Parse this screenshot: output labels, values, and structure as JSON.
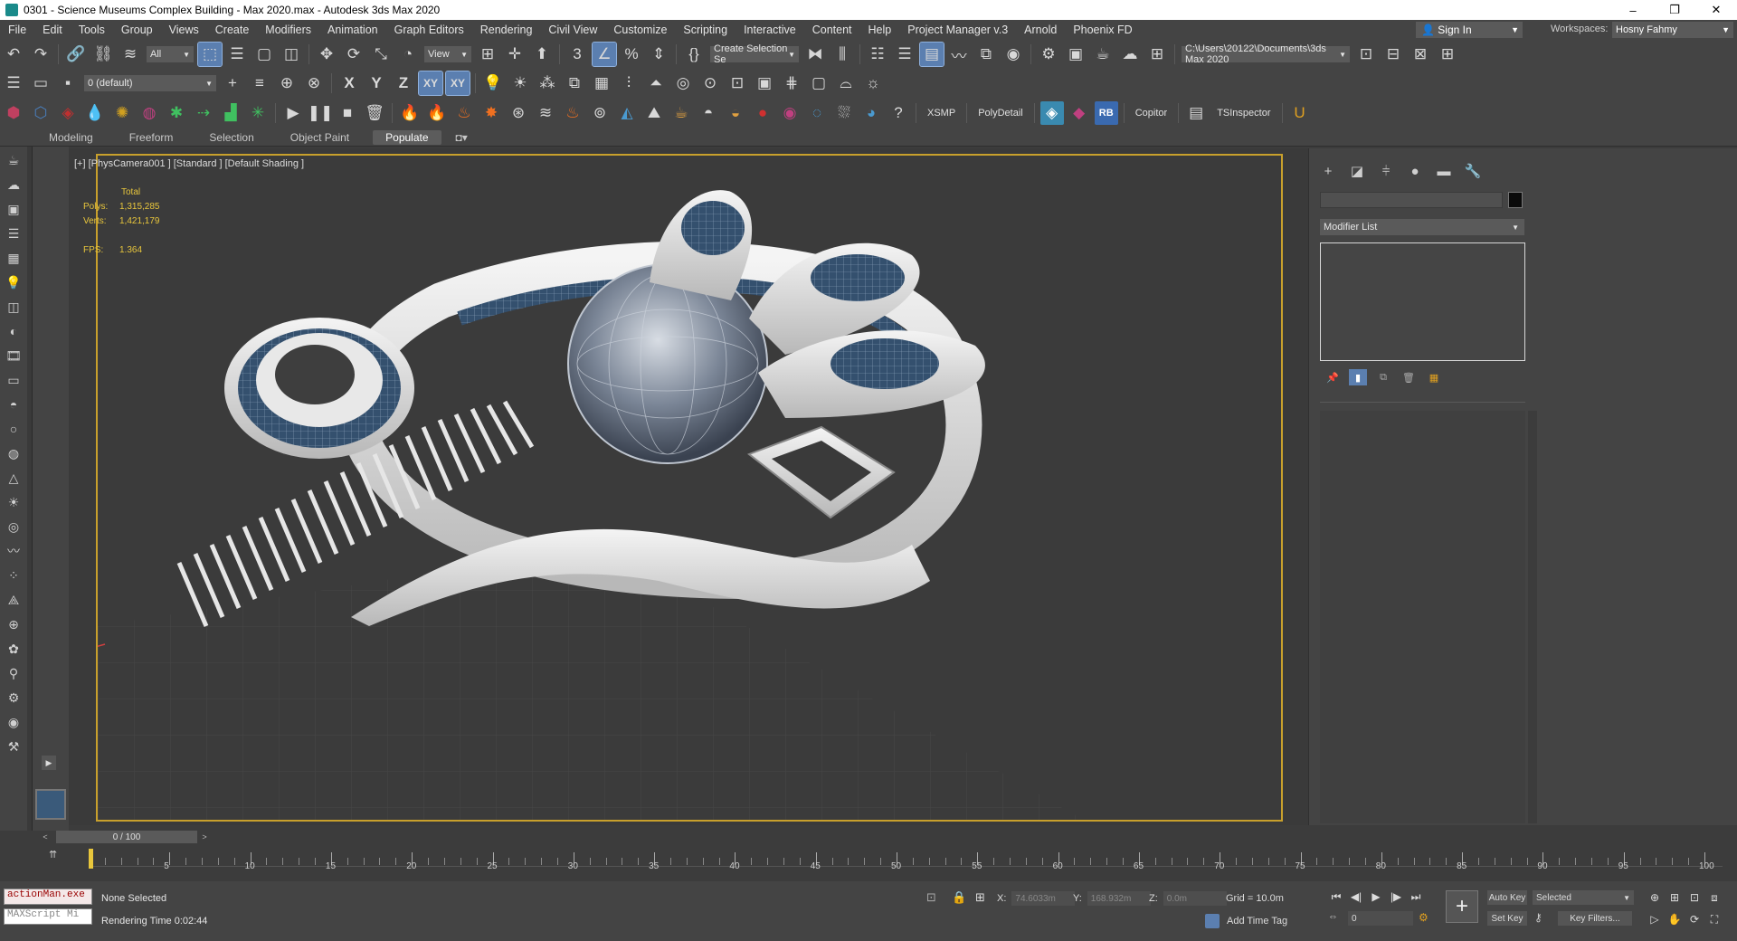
{
  "window": {
    "title": "0301 - Science Museums Complex Building - Max 2020.max - Autodesk 3ds Max 2020",
    "minimize": "–",
    "maximize": "❐",
    "close": "✕"
  },
  "menu": {
    "items": [
      "File",
      "Edit",
      "Tools",
      "Group",
      "Views",
      "Create",
      "Modifiers",
      "Animation",
      "Graph Editors",
      "Rendering",
      "Civil View",
      "Customize",
      "Scripting",
      "Interactive",
      "Content",
      "Help",
      "Project Manager v.3",
      "Arnold",
      "Phoenix FD"
    ],
    "sign_in": "Sign In",
    "workspaces_label": "Workspaces:",
    "workspace": "Hosny Fahmy"
  },
  "toolbar1": {
    "filter": "All",
    "ref_coord": "View",
    "selection_set": "Create Selection Se",
    "project_path": "C:\\Users\\20122\\Documents\\3ds Max 2020"
  },
  "toolbar2": {
    "layer": "0 (default)",
    "axes": [
      "X",
      "Y",
      "Z",
      "XY",
      "XY"
    ]
  },
  "toolbar3": {
    "labels": [
      "XSMP",
      "PolyDetail",
      "RB",
      "Copitor",
      "TSInspector"
    ]
  },
  "ribbon": {
    "tabs": [
      "Modeling",
      "Freeform",
      "Selection",
      "Object Paint",
      "Populate"
    ],
    "active": "Populate"
  },
  "viewport": {
    "label": "[+] [PhysCamera001 ] [Standard ] [Default Shading ]",
    "stats": {
      "total_label": "Total",
      "polys_label": "Polys:",
      "polys": "1,315,285",
      "verts_label": "Verts:",
      "verts": "1,421,179",
      "fps_label": "FPS:",
      "fps": "1.364"
    }
  },
  "command_panel": {
    "modifier_list": "Modifier List"
  },
  "timeline": {
    "frame_display": "0 / 100",
    "ticks": [
      0,
      5,
      10,
      15,
      20,
      25,
      30,
      35,
      40,
      45,
      50,
      55,
      60,
      65,
      70,
      75,
      80,
      85,
      90,
      95,
      100
    ],
    "current_frame": 0
  },
  "status": {
    "maxscript_line1": "actionMan.exe",
    "maxscript_line2": "MAXScript Mi",
    "selection": "None Selected",
    "render_time": "Rendering Time  0:02:44",
    "x_label": "X:",
    "x_value": "74.6033m",
    "y_label": "Y:",
    "y_value": "168.932m",
    "z_label": "Z:",
    "z_value": "0.0m",
    "grid": "Grid = 10.0m",
    "add_time_tag": "Add Time Tag",
    "frame_value": "0",
    "auto_key": "Auto Key",
    "set_key": "Set Key",
    "key_mode": "Selected",
    "key_filters": "Key Filters..."
  },
  "colors": {
    "ui_bg": "#444444",
    "viewport_bg": "#3b3b3b",
    "active_viewport_border": "#c8a02c",
    "stats_text": "#e8c63c",
    "selected_button": "#5b7fb0"
  }
}
